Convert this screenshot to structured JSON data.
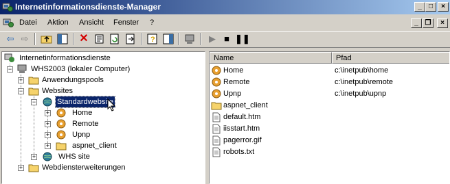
{
  "window": {
    "title": "Internetinformationsdienste-Manager"
  },
  "titlebar_buttons": {
    "minimize": "_",
    "maximize": "□",
    "close": "×"
  },
  "mdi_buttons": {
    "minimize": "_",
    "restore": "❐",
    "close": "×"
  },
  "menu": [
    {
      "label": "Datei"
    },
    {
      "label": "Aktion"
    },
    {
      "label": "Ansicht"
    },
    {
      "label": "Fenster"
    },
    {
      "label": "?"
    }
  ],
  "toolbar": {
    "back": "back-arrow",
    "forward": "forward-arrow",
    "up": "up-folder",
    "show_hide": "show-hide-tree",
    "delete": "delete",
    "properties": "properties",
    "refresh": "refresh",
    "export": "export-list",
    "help": "help",
    "action_pane": "action-pane",
    "computer": "computer",
    "play": "start",
    "stop": "stop",
    "pause": "pause"
  },
  "tree": {
    "root": "Internetinformationsdienste",
    "computer": "WHS2003 (lokaler Computer)",
    "app_pools": "Anwendungspools",
    "websites": "Websites",
    "default_site": "Standardwebsite",
    "home": "Home",
    "remote": "Remote",
    "upnp": "Upnp",
    "aspnet_client": "aspnet_client",
    "whs_site": "WHS site",
    "web_extensions": "Webdiensterweiterungen"
  },
  "list": {
    "columns": [
      "Name",
      "Pfad"
    ],
    "rows": [
      {
        "name": "Home",
        "path": "c:\\inetpub\\home",
        "icon": "virtual-dir"
      },
      {
        "name": "Remote",
        "path": "c:\\inetpub\\remote",
        "icon": "virtual-dir"
      },
      {
        "name": "Upnp",
        "path": "c:\\inetpub\\upnp",
        "icon": "virtual-dir"
      },
      {
        "name": "aspnet_client",
        "path": "",
        "icon": "folder"
      },
      {
        "name": "default.htm",
        "path": "",
        "icon": "file"
      },
      {
        "name": "iisstart.htm",
        "path": "",
        "icon": "file"
      },
      {
        "name": "pagerror.gif",
        "path": "",
        "icon": "file"
      },
      {
        "name": "robots.txt",
        "path": "",
        "icon": "file"
      }
    ]
  },
  "colors": {
    "title_start": "#0a246a",
    "title_end": "#a6caf0",
    "face": "#d4d0c8",
    "selection": "#0a246a"
  }
}
